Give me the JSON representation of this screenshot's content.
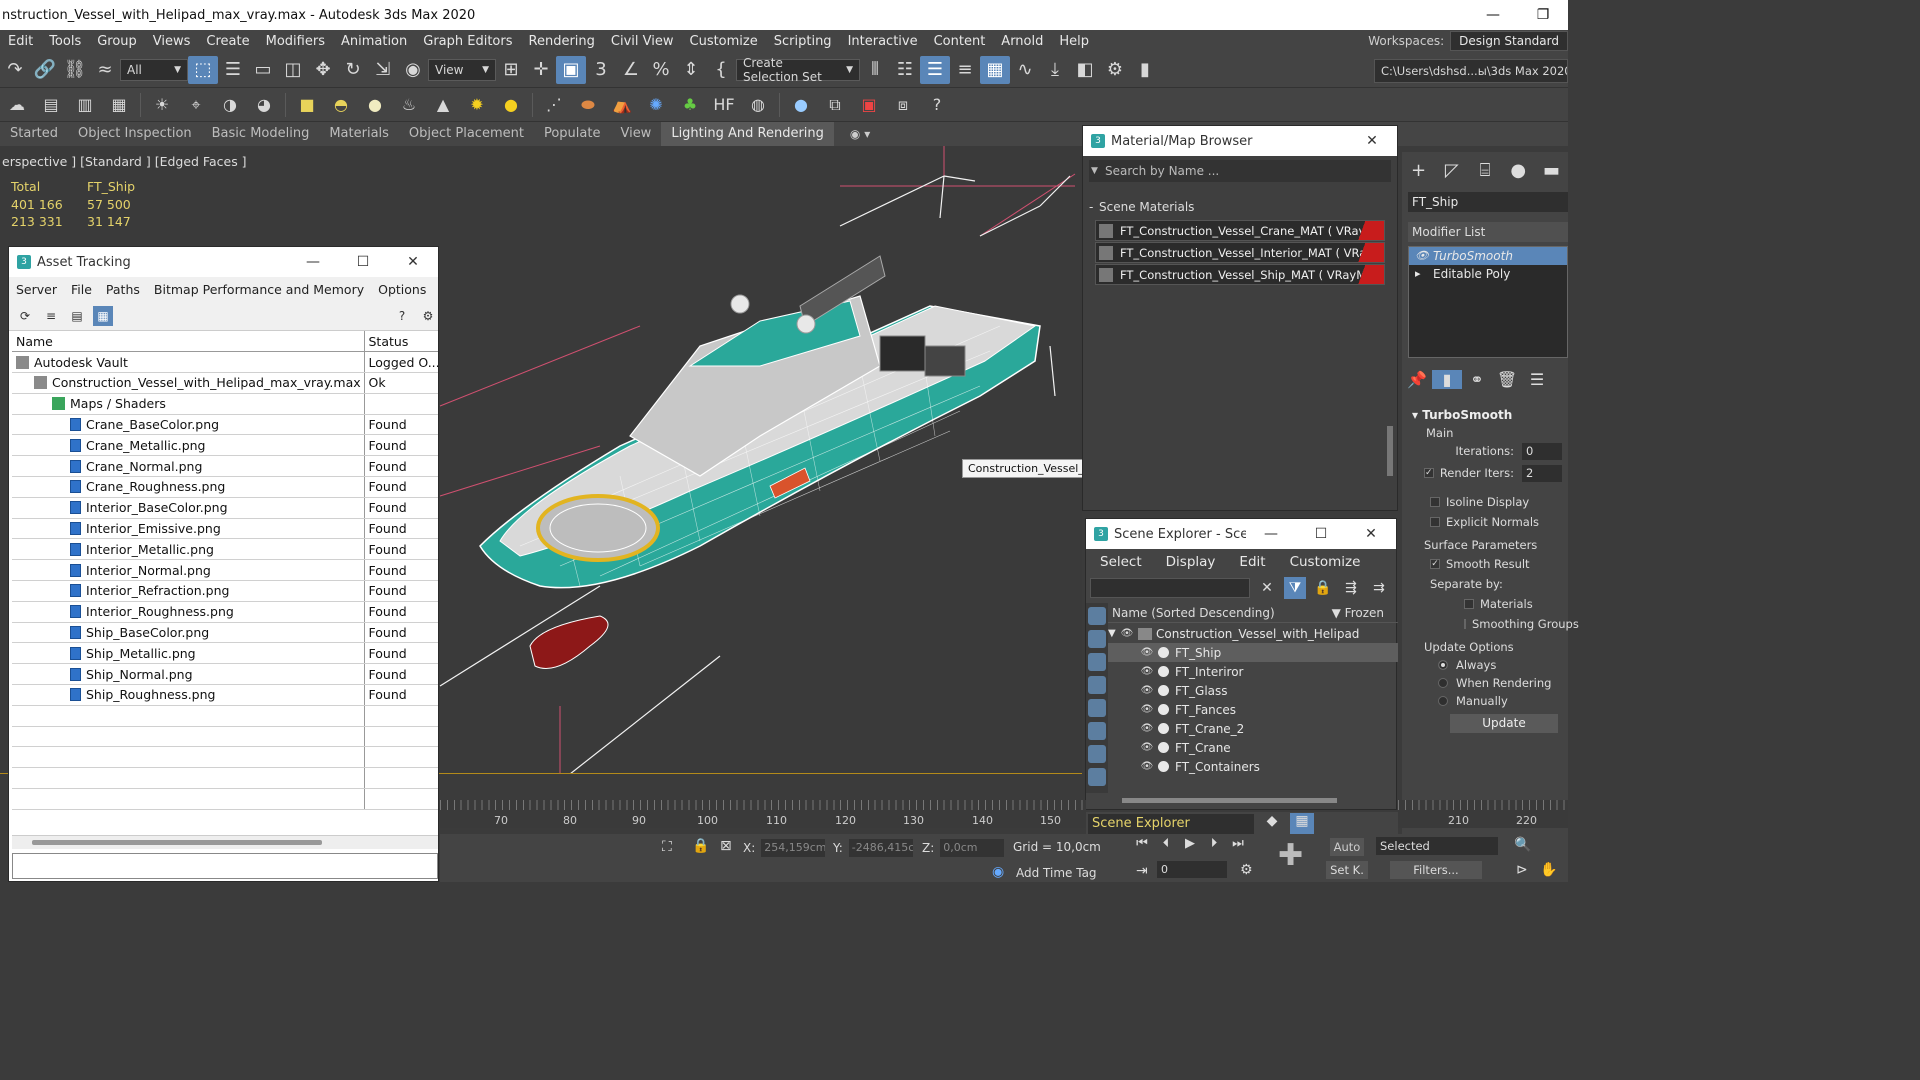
{
  "window": {
    "title": "nstruction_Vessel_with_Helipad_max_vray.max - Autodesk 3ds Max 2020",
    "buttons": [
      "—",
      "❐"
    ]
  },
  "menu": [
    "Edit",
    "Tools",
    "Group",
    "Views",
    "Create",
    "Modifiers",
    "Animation",
    "Graph Editors",
    "Rendering",
    "Civil View",
    "Customize",
    "Scripting",
    "Interactive",
    "Content",
    "Arnold",
    "Help"
  ],
  "workspaces": {
    "label": "Workspaces:",
    "value": "Design Standard"
  },
  "toolbar": {
    "filter_select": "All",
    "ref_coord": "View",
    "selection_set": "Create Selection Set",
    "project_path": "C:\\Users\\dshsd...ы\\3ds Max 2020"
  },
  "ribbon_tabs": [
    "Started",
    "Object Inspection",
    "Basic Modeling",
    "Materials",
    "Object Placement",
    "Populate",
    "View",
    "Lighting And Rendering"
  ],
  "ribbon_active": "Lighting And Rendering",
  "viewport": {
    "label": "erspective ] [Standard ] [Edged Faces ]",
    "stats": {
      "headers": [
        "Total",
        "FT_Ship"
      ],
      "rows": [
        [
          "401 166",
          "57 500"
        ],
        [
          "213 331",
          "31 147"
        ]
      ]
    },
    "tooltip": "Construction_Vessel_with_Helipad"
  },
  "asset_tracking": {
    "title": "Asset Tracking",
    "menu": [
      "Server",
      "File",
      "Paths",
      "Bitmap Performance and Memory",
      "Options"
    ],
    "columns": [
      "Name",
      "Status"
    ],
    "rows": [
      {
        "name": "Autodesk Vault",
        "status": "Logged O...",
        "indent": 0,
        "icon": "vault"
      },
      {
        "name": "Construction_Vessel_with_Helipad_max_vray.max",
        "status": "Ok",
        "indent": 1,
        "icon": "max"
      },
      {
        "name": "Maps / Shaders",
        "status": "",
        "indent": 2,
        "icon": "maps"
      },
      {
        "name": "Crane_BaseColor.png",
        "status": "Found",
        "indent": 3,
        "icon": "file"
      },
      {
        "name": "Crane_Metallic.png",
        "status": "Found",
        "indent": 3,
        "icon": "file"
      },
      {
        "name": "Crane_Normal.png",
        "status": "Found",
        "indent": 3,
        "icon": "file"
      },
      {
        "name": "Crane_Roughness.png",
        "status": "Found",
        "indent": 3,
        "icon": "file"
      },
      {
        "name": "Interior_BaseColor.png",
        "status": "Found",
        "indent": 3,
        "icon": "file"
      },
      {
        "name": "Interior_Emissive.png",
        "status": "Found",
        "indent": 3,
        "icon": "file"
      },
      {
        "name": "Interior_Metallic.png",
        "status": "Found",
        "indent": 3,
        "icon": "file"
      },
      {
        "name": "Interior_Normal.png",
        "status": "Found",
        "indent": 3,
        "icon": "file"
      },
      {
        "name": "Interior_Refraction.png",
        "status": "Found",
        "indent": 3,
        "icon": "file"
      },
      {
        "name": "Interior_Roughness.png",
        "status": "Found",
        "indent": 3,
        "icon": "file"
      },
      {
        "name": "Ship_BaseColor.png",
        "status": "Found",
        "indent": 3,
        "icon": "file"
      },
      {
        "name": "Ship_Metallic.png",
        "status": "Found",
        "indent": 3,
        "icon": "file"
      },
      {
        "name": "Ship_Normal.png",
        "status": "Found",
        "indent": 3,
        "icon": "file"
      },
      {
        "name": "Ship_Roughness.png",
        "status": "Found",
        "indent": 3,
        "icon": "file"
      }
    ]
  },
  "material_browser": {
    "title": "Material/Map Browser",
    "search_placeholder": "Search by Name ...",
    "section": "Scene Materials",
    "materials": [
      "FT_Construction_Vessel_Crane_MAT  ( VRayMtl...",
      "FT_Construction_Vessel_Interior_MAT  ( VRayMt...",
      "FT_Construction_Vessel_Ship_MAT  ( VRayMtl )..."
    ]
  },
  "scene_explorer": {
    "title": "Scene Explorer - Sce...",
    "menu": [
      "Select",
      "Display",
      "Edit",
      "Customize"
    ],
    "col_name": "Name (Sorted Descending)",
    "col_frozen": "Frozen",
    "root": "Construction_Vessel_with_Helipad",
    "objects": [
      "FT_Ship",
      "FT_Interiror",
      "FT_Glass",
      "FT_Fances",
      "FT_Crane_2",
      "FT_Crane",
      "FT_Containers"
    ],
    "selected": "FT_Ship",
    "footer_label": "Scene Explorer"
  },
  "command_panel": {
    "object_name": "FT_Ship",
    "modifier_list": "Modifier List",
    "stack": [
      "TurboSmooth",
      "Editable Poly"
    ],
    "rollout": "TurboSmooth",
    "main": "Main",
    "iterations_label": "Iterations:",
    "iterations": "0",
    "render_iters_label": "Render Iters:",
    "render_iters": "2",
    "isoline": "Isoline Display",
    "explicit_normals": "Explicit Normals",
    "surface_params": "Surface Parameters",
    "smooth_result": "Smooth Result",
    "separate_by": "Separate by:",
    "materials": "Materials",
    "smoothing_groups": "Smoothing Groups",
    "update_options": "Update Options",
    "always": "Always",
    "when_rendering": "When Rendering",
    "manually": "Manually",
    "update_btn": "Update"
  },
  "timeline": {
    "ticks": [
      "70",
      "80",
      "90",
      "100",
      "110",
      "120",
      "130",
      "140",
      "150"
    ],
    "ticks_right": [
      "210",
      "220"
    ]
  },
  "status": {
    "x_label": "X:",
    "x": "254,159cm",
    "y_label": "Y:",
    "y": "-2486,415c",
    "z_label": "Z:",
    "z": "0,0cm",
    "grid": "Grid = 10,0cm",
    "add_time_tag": "Add Time Tag",
    "frame": "0",
    "auto": "Auto",
    "set_k": "Set K.",
    "selected": "Selected",
    "filters": "Filters..."
  },
  "colors": {
    "accent": "#5a86b8",
    "stat_yellow": "#e5d36a",
    "material_red": "#c81c1c"
  }
}
